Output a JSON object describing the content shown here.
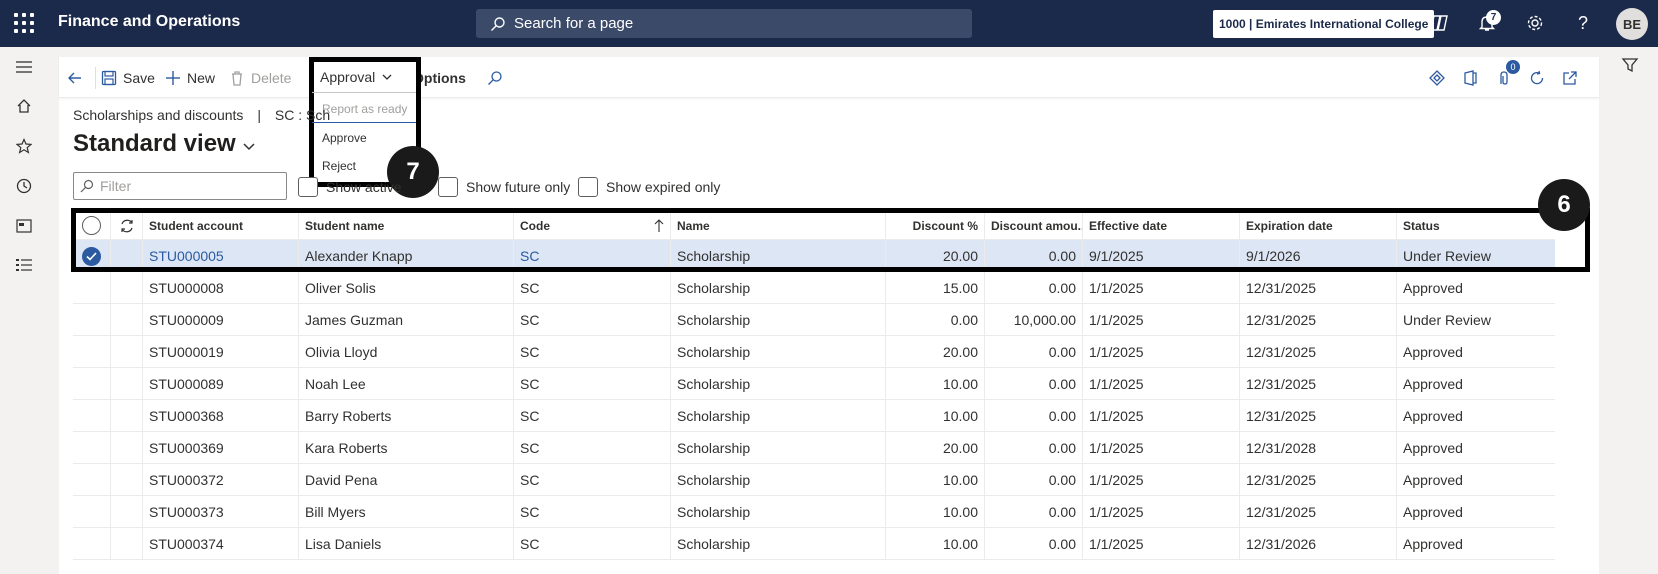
{
  "topbar": {
    "app_title": "Finance and Operations",
    "search_placeholder": "Search for a page",
    "company": "1000 | Emirates International College",
    "notification_count": "7",
    "avatar_initials": "BE"
  },
  "actionbar": {
    "save": "Save",
    "new": "New",
    "delete": "Delete",
    "approval": "Approval",
    "options": "Options",
    "attachments_count": "0"
  },
  "approval_menu": {
    "items": [
      "Report as ready",
      "Approve",
      "Reject"
    ]
  },
  "callouts": {
    "menu": "7",
    "grid": "6"
  },
  "breadcrumb": {
    "page": "Scholarships and discounts",
    "separator": "|",
    "record": "SC : Sch"
  },
  "view": {
    "title": "Standard view"
  },
  "filters": {
    "filter_placeholder": "Filter",
    "show_active": "Show active",
    "show_future_only": "Show future only",
    "show_expired_only": "Show expired only"
  },
  "grid": {
    "columns": [
      "Student account",
      "Student name",
      "Code",
      "Name",
      "Discount %",
      "Discount amou...",
      "Effective date",
      "Expiration date",
      "Status"
    ],
    "rows": [
      {
        "account": "STU000005",
        "name": "Alexander Knapp",
        "code": "SC",
        "type": "Scholarship",
        "pct": "20.00",
        "amount": "0.00",
        "effective": "9/1/2025",
        "expiration": "9/1/2026",
        "status": "Under Review",
        "selected": true
      },
      {
        "account": "STU000008",
        "name": "Oliver Solis",
        "code": "SC",
        "type": "Scholarship",
        "pct": "15.00",
        "amount": "0.00",
        "effective": "1/1/2025",
        "expiration": "12/31/2025",
        "status": "Approved"
      },
      {
        "account": "STU000009",
        "name": "James Guzman",
        "code": "SC",
        "type": "Scholarship",
        "pct": "0.00",
        "amount": "10,000.00",
        "effective": "1/1/2025",
        "expiration": "12/31/2025",
        "status": "Under Review"
      },
      {
        "account": "STU000019",
        "name": "Olivia Lloyd",
        "code": "SC",
        "type": "Scholarship",
        "pct": "20.00",
        "amount": "0.00",
        "effective": "1/1/2025",
        "expiration": "12/31/2025",
        "status": "Approved"
      },
      {
        "account": "STU000089",
        "name": "Noah Lee",
        "code": "SC",
        "type": "Scholarship",
        "pct": "10.00",
        "amount": "0.00",
        "effective": "1/1/2025",
        "expiration": "12/31/2025",
        "status": "Approved"
      },
      {
        "account": "STU000368",
        "name": "Barry Roberts",
        "code": "SC",
        "type": "Scholarship",
        "pct": "10.00",
        "amount": "0.00",
        "effective": "1/1/2025",
        "expiration": "12/31/2025",
        "status": "Approved"
      },
      {
        "account": "STU000369",
        "name": "Kara Roberts",
        "code": "SC",
        "type": "Scholarship",
        "pct": "20.00",
        "amount": "0.00",
        "effective": "1/1/2025",
        "expiration": "12/31/2028",
        "status": "Approved"
      },
      {
        "account": "STU000372",
        "name": "David Pena",
        "code": "SC",
        "type": "Scholarship",
        "pct": "10.00",
        "amount": "0.00",
        "effective": "1/1/2025",
        "expiration": "12/31/2025",
        "status": "Approved"
      },
      {
        "account": "STU000373",
        "name": "Bill Myers",
        "code": "SC",
        "type": "Scholarship",
        "pct": "10.00",
        "amount": "0.00",
        "effective": "1/1/2025",
        "expiration": "12/31/2025",
        "status": "Approved"
      },
      {
        "account": "STU000374",
        "name": "Lisa Daniels",
        "code": "SC",
        "type": "Scholarship",
        "pct": "10.00",
        "amount": "0.00",
        "effective": "1/1/2025",
        "expiration": "12/31/2026",
        "status": "Approved"
      }
    ]
  },
  "colors": {
    "navbar": "#1b2a4a",
    "accent": "#2c5aa0",
    "selected_row": "#dde6f5"
  }
}
